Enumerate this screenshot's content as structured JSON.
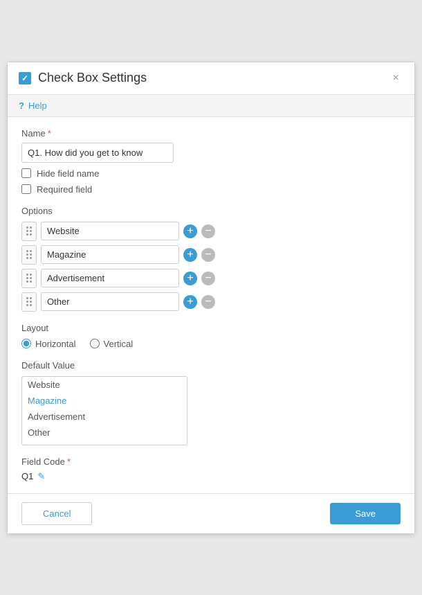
{
  "dialog": {
    "title": "Check Box Settings",
    "close_label": "×"
  },
  "help": {
    "icon": "?",
    "label": "Help"
  },
  "name_field": {
    "label": "Name",
    "required": "*",
    "value": "Q1. How did you get to know",
    "hide_field_name_label": "Hide field name",
    "required_field_label": "Required field"
  },
  "options": {
    "label": "Options",
    "items": [
      {
        "value": "Website"
      },
      {
        "value": "Magazine"
      },
      {
        "value": "Advertisement"
      },
      {
        "value": "Other"
      }
    ]
  },
  "layout": {
    "label": "Layout",
    "options": [
      {
        "value": "horizontal",
        "label": "Horizontal",
        "checked": true
      },
      {
        "value": "vertical",
        "label": "Vertical",
        "checked": false
      }
    ]
  },
  "default_value": {
    "label": "Default Value",
    "items": [
      {
        "value": "Website",
        "blue": false
      },
      {
        "value": "Magazine",
        "blue": true
      },
      {
        "value": "Advertisement",
        "blue": false
      },
      {
        "value": "Other",
        "blue": false
      }
    ]
  },
  "field_code": {
    "label": "Field Code",
    "required": "*",
    "value": "Q1"
  },
  "footer": {
    "cancel_label": "Cancel",
    "save_label": "Save"
  }
}
